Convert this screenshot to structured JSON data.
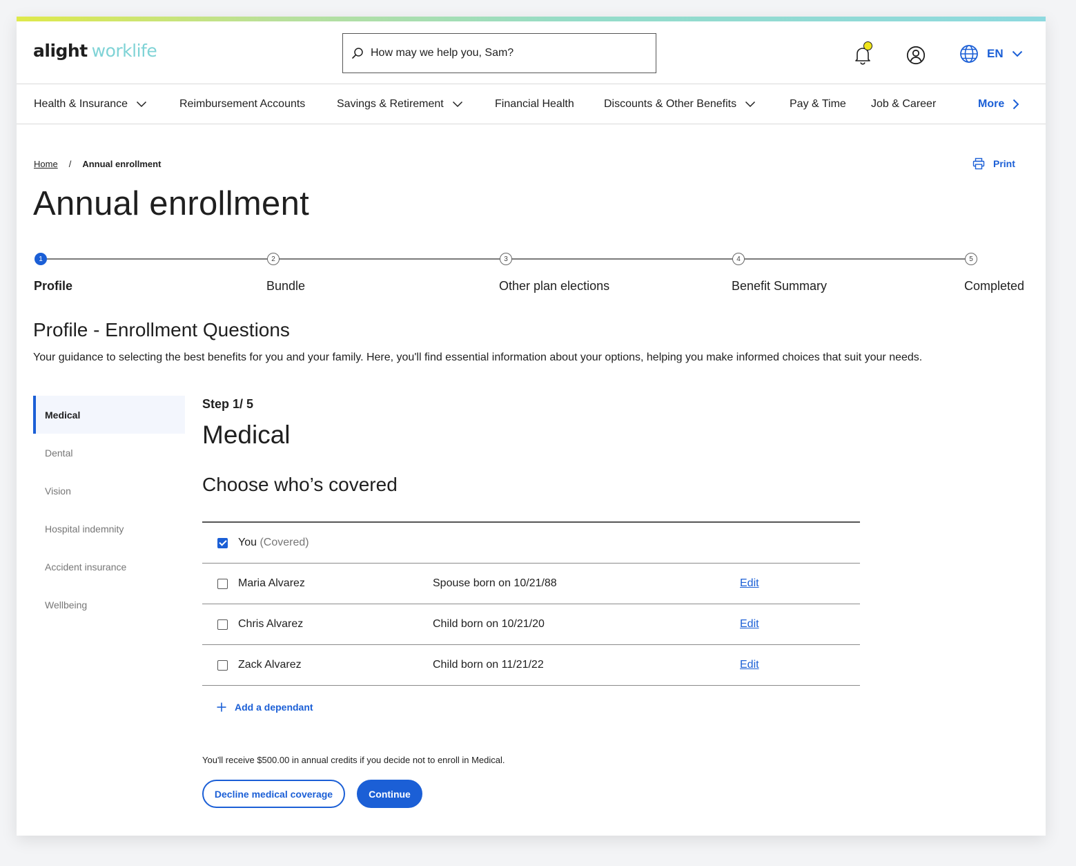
{
  "colors": {
    "accent": "#1b5fd6",
    "notification_dot": "#f0e51c",
    "logo_secondary": "#7fd3d6"
  },
  "header": {
    "logo_primary": "alight",
    "logo_secondary": "worklife",
    "search_placeholder": "How may we help you, Sam?",
    "language": "EN",
    "icons": [
      "search-icon",
      "bell-icon",
      "user-icon",
      "globe-icon",
      "chevron-down-icon"
    ]
  },
  "nav": {
    "items": [
      {
        "label": "Health & Insurance",
        "has_dropdown": true
      },
      {
        "label": "Reimbursement Accounts",
        "has_dropdown": false
      },
      {
        "label": "Savings & Retirement",
        "has_dropdown": true
      },
      {
        "label": "Financial Health",
        "has_dropdown": false
      },
      {
        "label": "Discounts & Other Benefits",
        "has_dropdown": true
      },
      {
        "label": "Pay & Time",
        "has_dropdown": false
      },
      {
        "label": "Job & Career",
        "has_dropdown": false
      }
    ],
    "more_label": "More"
  },
  "breadcrumb": {
    "home": "Home",
    "separator": "/",
    "current": "Annual enrollment"
  },
  "print_label": "Print",
  "page_title": "Annual enrollment",
  "stepper": {
    "steps": [
      {
        "number": "1",
        "label": "Profile",
        "active": true
      },
      {
        "number": "2",
        "label": "Bundle",
        "active": false
      },
      {
        "number": "3",
        "label": "Other plan elections",
        "active": false
      },
      {
        "number": "4",
        "label": "Benefit Summary",
        "active": false
      },
      {
        "number": "5",
        "label": "Completed",
        "active": false
      }
    ]
  },
  "section": {
    "title": "Profile - Enrollment Questions",
    "description": "Your guidance to selecting the best benefits for you and your family. Here, you'll find essential information about your options, helping you make informed choices that suit your needs."
  },
  "sidebar": {
    "items": [
      {
        "label": "Medical",
        "active": true
      },
      {
        "label": "Dental",
        "active": false
      },
      {
        "label": "Vision",
        "active": false
      },
      {
        "label": "Hospital indemnity",
        "active": false
      },
      {
        "label": "Accident insurance",
        "active": false
      },
      {
        "label": "Wellbeing",
        "active": false
      }
    ]
  },
  "main": {
    "step_count": "Step 1/ 5",
    "title": "Medical",
    "subtitle": "Choose who’s covered",
    "covered": [
      {
        "name": "You",
        "note": "(Covered)",
        "relationship": "",
        "checked": true,
        "edit": ""
      },
      {
        "name": "Maria Alvarez",
        "note": "",
        "relationship": "Spouse born on 10/21/88",
        "checked": false,
        "edit": "Edit"
      },
      {
        "name": "Chris Alvarez",
        "note": "",
        "relationship": "Child born on 10/21/20",
        "checked": false,
        "edit": "Edit"
      },
      {
        "name": "Zack Alvarez",
        "note": "",
        "relationship": "Child born on 11/21/22",
        "checked": false,
        "edit": "Edit"
      }
    ],
    "add_dependant": "Add a dependant",
    "credit_note": "You'll receive $500.00 in annual credits if you decide not to enroll in Medical.",
    "decline_button": "Decline medical coverage",
    "continue_button": "Continue"
  }
}
